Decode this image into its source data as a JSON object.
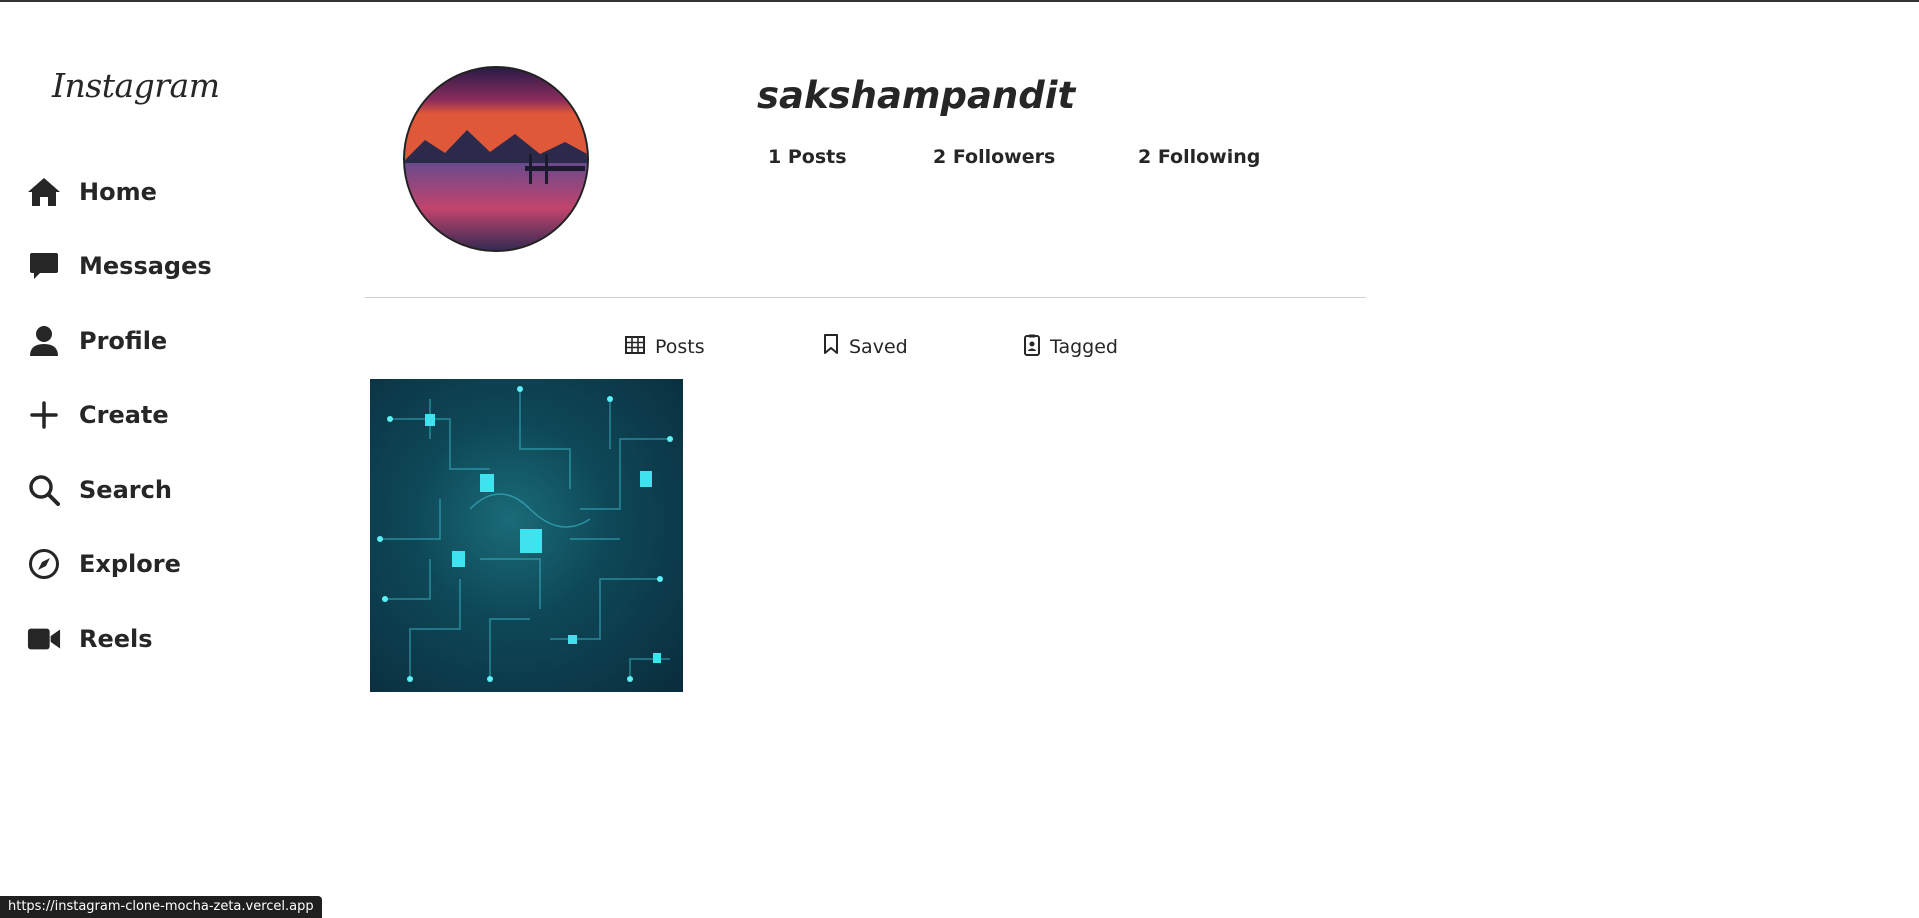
{
  "app": {
    "logo_text": "Instagram"
  },
  "sidebar": {
    "items": [
      {
        "label": "Home",
        "icon": "home-icon"
      },
      {
        "label": "Messages",
        "icon": "message-icon"
      },
      {
        "label": "Profile",
        "icon": "person-icon"
      },
      {
        "label": "Create",
        "icon": "plus-icon"
      },
      {
        "label": "Search",
        "icon": "search-icon"
      },
      {
        "label": "Explore",
        "icon": "compass-icon"
      },
      {
        "label": "Reels",
        "icon": "video-icon"
      }
    ]
  },
  "profile": {
    "username": "sakshampandit",
    "posts": "1 Posts",
    "followers": "2 Followers",
    "following": "2 Following"
  },
  "tabs": [
    {
      "label": "Posts",
      "icon": "grid-icon"
    },
    {
      "label": "Saved",
      "icon": "bookmark-icon"
    },
    {
      "label": "Tagged",
      "icon": "tagged-icon"
    }
  ],
  "status_bar": {
    "url": "https://instagram-clone-mocha-zeta.vercel.app"
  },
  "colors": {
    "text": "#262626",
    "divider": "#cfcfcf",
    "background": "#ffffff"
  }
}
